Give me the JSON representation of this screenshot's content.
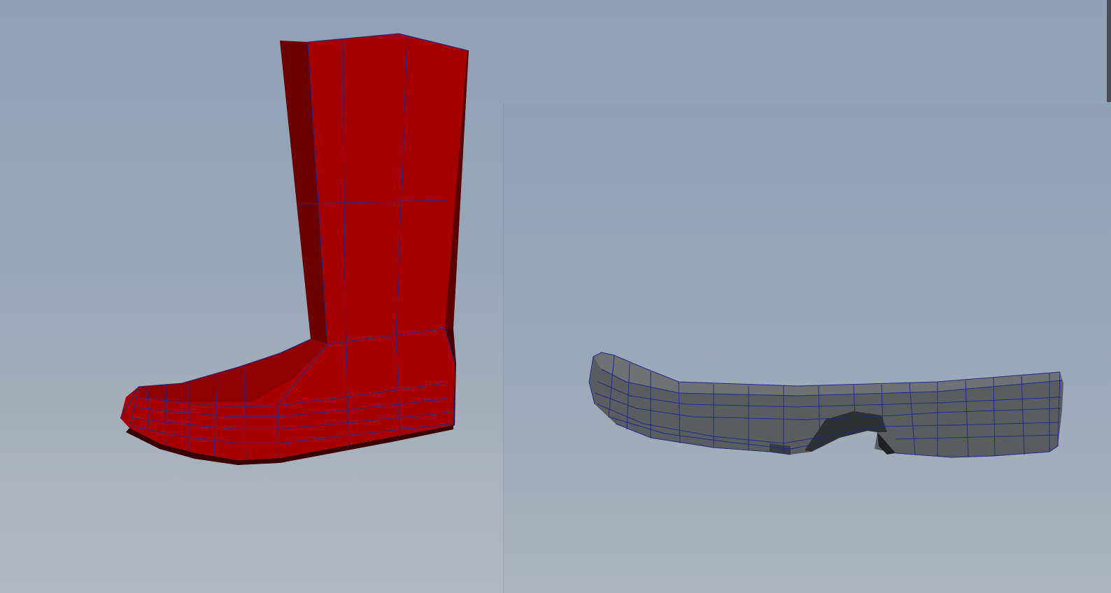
{
  "scene": {
    "viewports": [
      {
        "id": "left",
        "object": "boot"
      },
      {
        "id": "right",
        "object": "sole"
      }
    ],
    "colors": {
      "background_top": "#8ea1b6",
      "background_bottom": "#b3b8be",
      "boot_red": "#a30000",
      "boot_shadow": "#6a0000",
      "sole_gray": "#5b5d60",
      "wireframe": "#1f2a8a"
    }
  }
}
